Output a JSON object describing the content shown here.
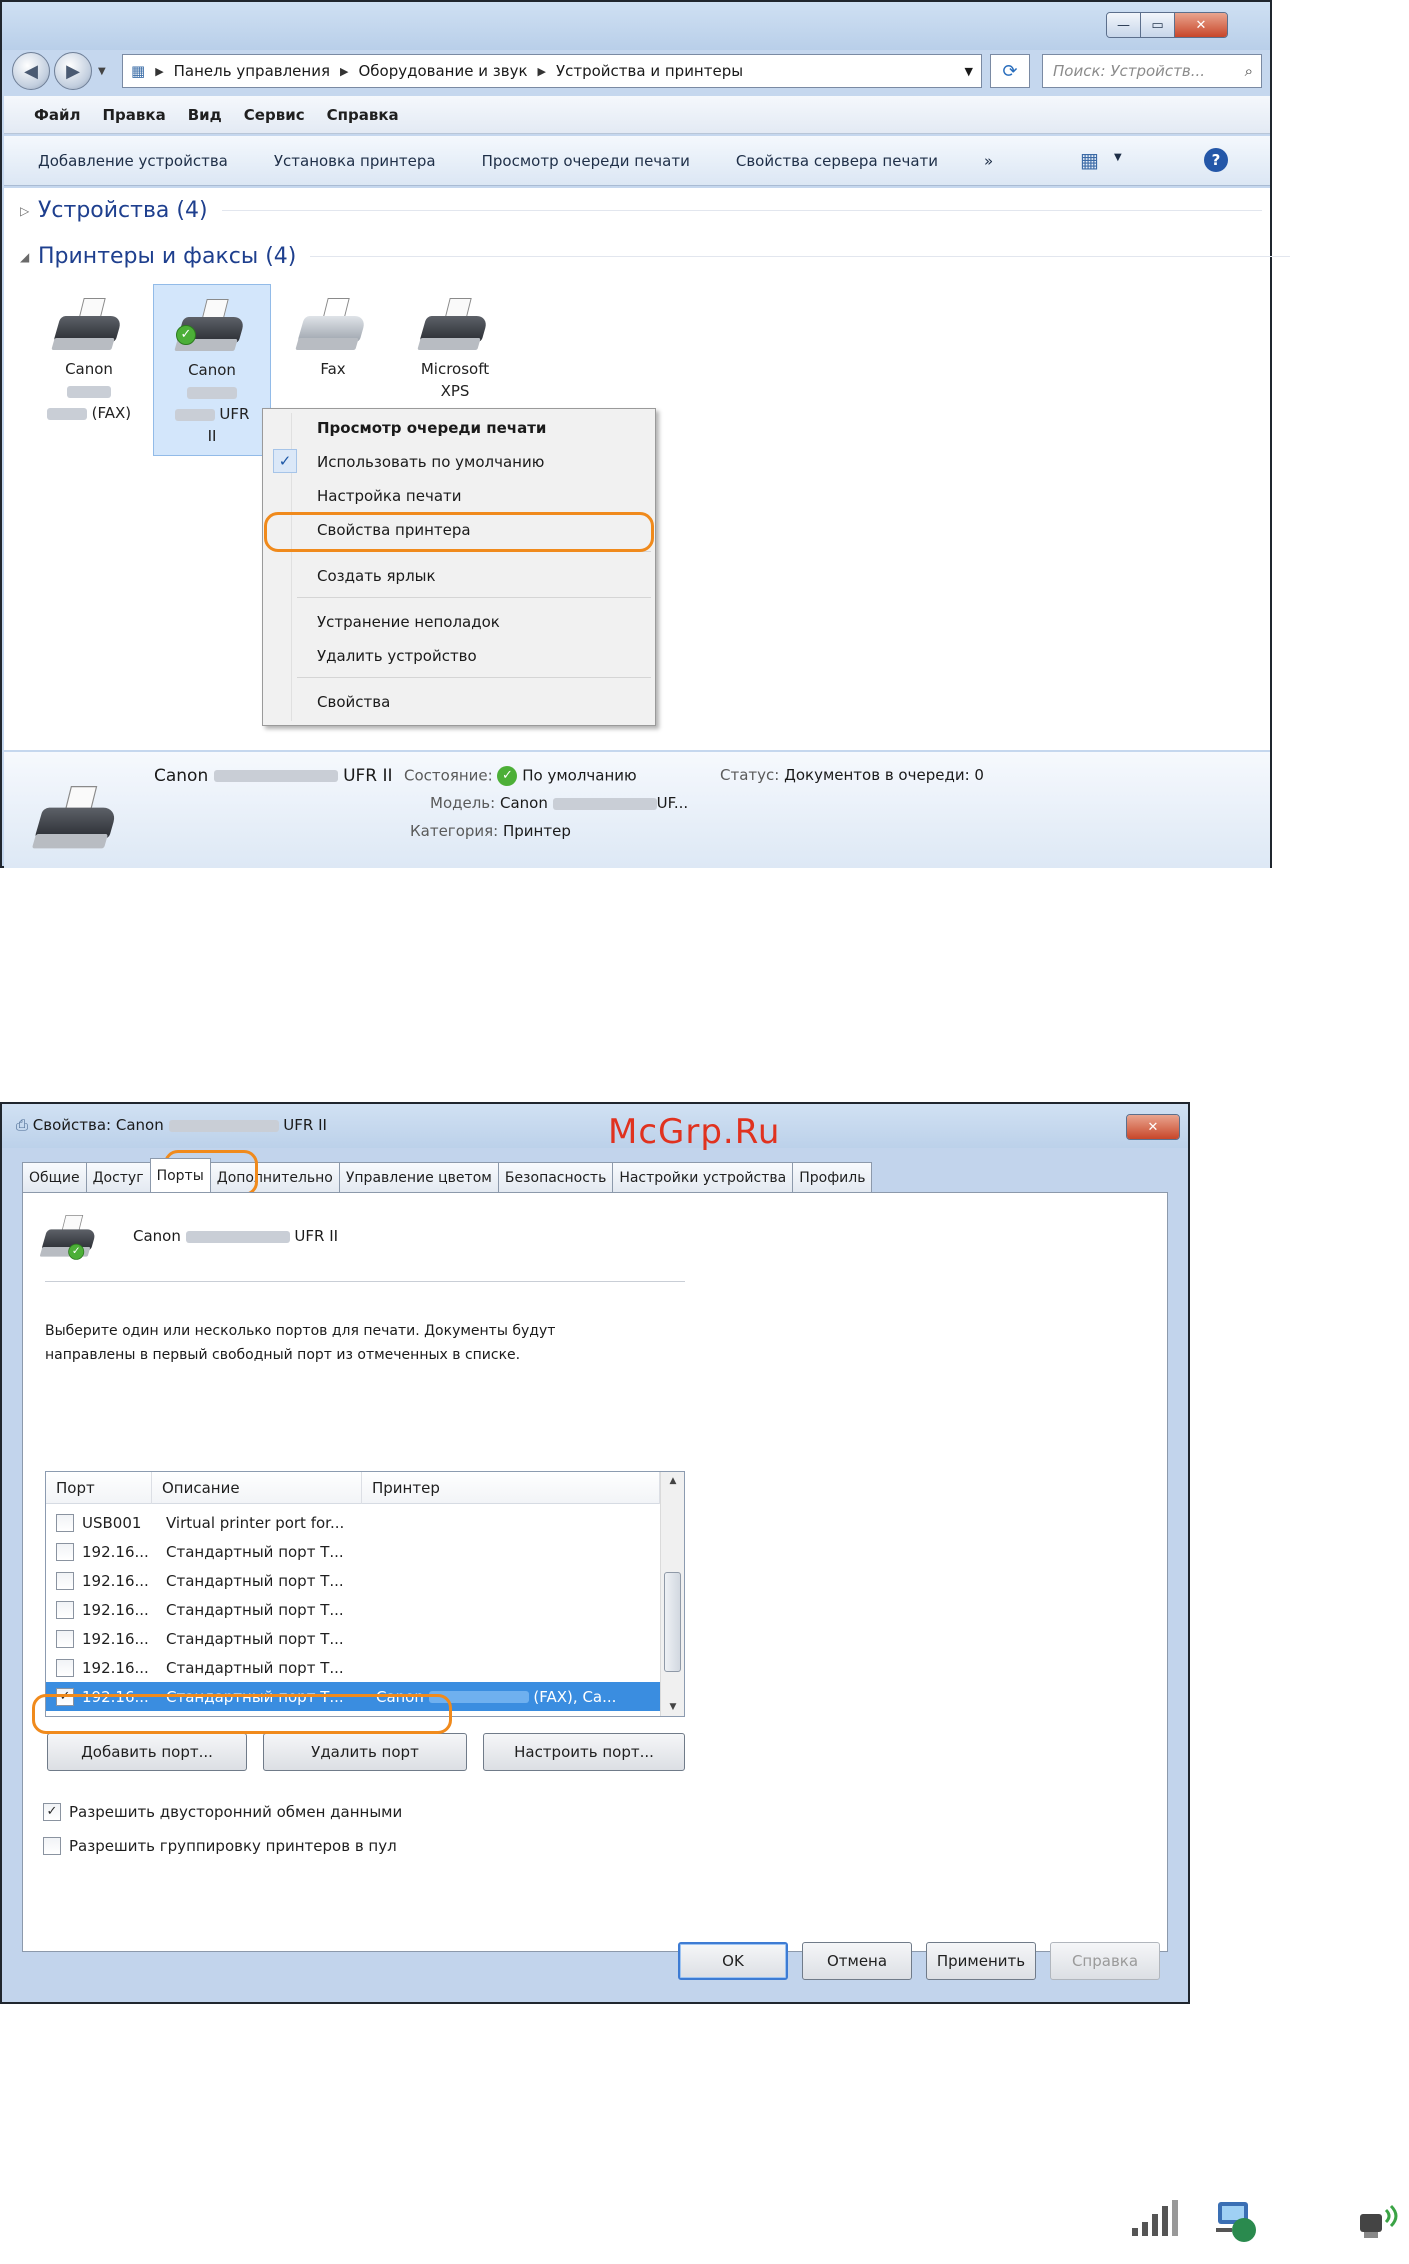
{
  "win1": {
    "address": [
      "Панель управления",
      "Оборудование и звук",
      "Устройства и принтеры"
    ],
    "search_placeholder": "Поиск: Устройств...",
    "menu": [
      "Файл",
      "Правка",
      "Вид",
      "Сервис",
      "Справка"
    ],
    "commands": [
      "Добавление устройства",
      "Установка принтера",
      "Просмотр очереди печати",
      "Свойства сервера печати",
      "»"
    ],
    "groups": {
      "devices": "Устройства (4)",
      "printers": "Принтеры и факсы (4)"
    },
    "items": [
      {
        "line1": "Canon",
        "line3": "(FAX)"
      },
      {
        "line1": "Canon",
        "line3": "UFR",
        "line4": "II",
        "default": true
      },
      {
        "line1": "Fax"
      },
      {
        "line1": "Microsoft",
        "line2": "XPS"
      }
    ],
    "context_menu": {
      "view_queue": "Просмотр очереди печати",
      "set_default": "Использовать по умолчанию",
      "print_prefs": "Настройка печати",
      "printer_props": "Свойства принтера",
      "create_shortcut": "Создать ярлык",
      "troubleshoot": "Устранение неполадок",
      "remove": "Удалить устройство",
      "properties": "Свойства"
    },
    "details": {
      "name_a": "Canon",
      "name_b": "UFR II",
      "state_label": "Состояние:",
      "state_value": "По умолчанию",
      "status_label": "Статус:",
      "status_value": "Документов в очереди: 0",
      "model_label": "Модель:",
      "model_a": "Canon",
      "model_b": "UF...",
      "category_label": "Категория:",
      "category_value": "Принтер"
    }
  },
  "win2": {
    "title_a": "Свойства: Canon",
    "title_b": "UFR II",
    "watermark": "McGrp.Ru",
    "tabs": [
      "Общие",
      "Достуг",
      "Порты",
      "Дополнительно",
      "Управление цветом",
      "Безопасность",
      "Настройки устройства",
      "Профиль"
    ],
    "printer_name_a": "Canon",
    "printer_name_b": "UFR II",
    "instructions_1": "Выберите один или несколько портов для печати. Документы будут",
    "instructions_2": "направлены в первый свободный порт из отмеченных в списке.",
    "columns": [
      "Порт",
      "Описание",
      "Принтер"
    ],
    "ports": [
      {
        "port": "USB001",
        "desc": "Virtual printer port for...",
        "printer": "",
        "checked": false
      },
      {
        "port": "192.16...",
        "desc": "Стандартный порт Т...",
        "printer": "",
        "checked": false
      },
      {
        "port": "192.16...",
        "desc": "Стандартный порт Т...",
        "printer": "",
        "checked": false
      },
      {
        "port": "192.16...",
        "desc": "Стандартный порт Т...",
        "printer": "",
        "checked": false
      },
      {
        "port": "192.16...",
        "desc": "Стандартный порт Т...",
        "printer": "",
        "checked": false
      },
      {
        "port": "192.16...",
        "desc": "Стандартный порт Т...",
        "printer": "",
        "checked": false
      },
      {
        "port": "192.16...",
        "desc": "Стандартный порт Т...",
        "printer": "Canon",
        "printer_b": "(FAX), Ca...",
        "checked": true
      }
    ],
    "add_port": "Добавить порт...",
    "delete_port": "Удалить порт",
    "configure_port": "Настроить порт...",
    "bidirectional": "Разрешить двусторонний обмен данными",
    "pooling": "Разрешить группировку принтеров в пул",
    "ok": "OK",
    "cancel": "Отмена",
    "apply": "Применить",
    "help": "Справка"
  },
  "colors": {
    "highlight": "#f08a1c",
    "selection": "#3a8de0",
    "link_blue": "#1e3f8e"
  }
}
